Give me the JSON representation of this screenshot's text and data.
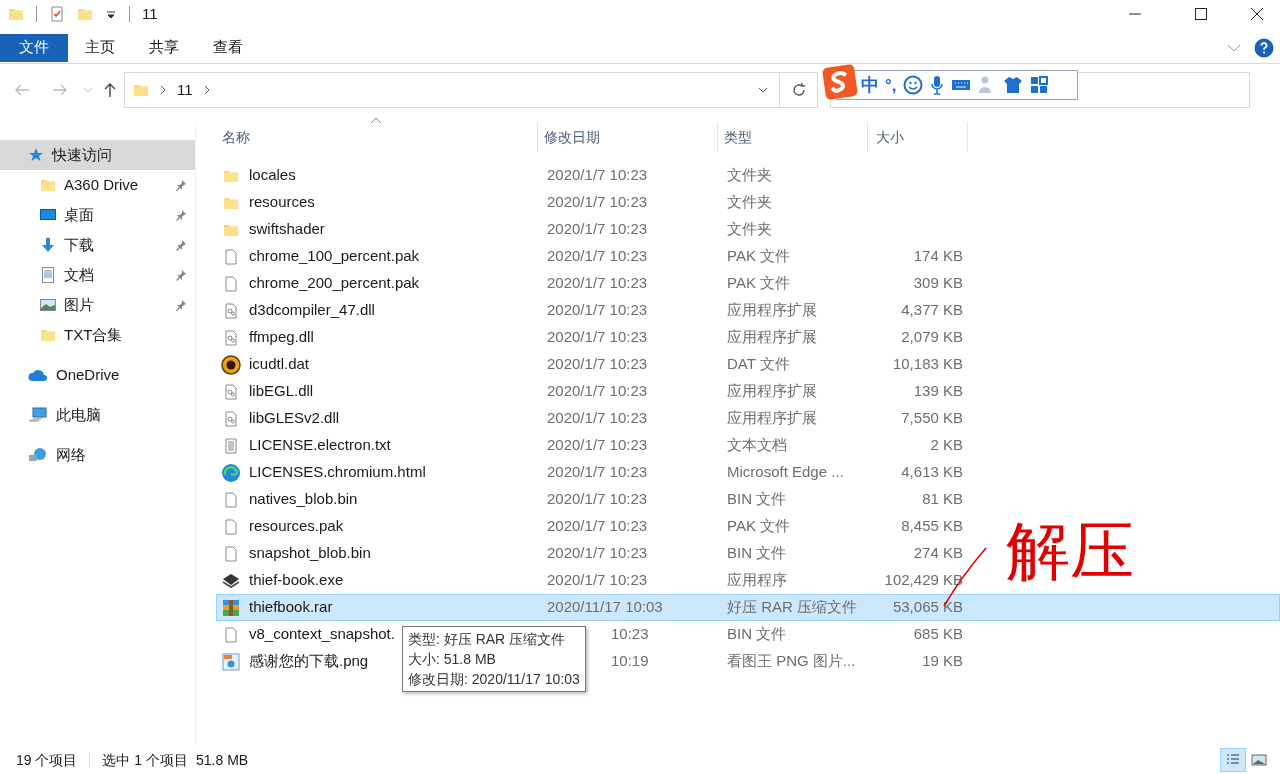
{
  "window": {
    "title": "11"
  },
  "ribbon_tabs": [
    {
      "label": "文件",
      "kind": "file"
    },
    {
      "label": "主页",
      "kind": "tab"
    },
    {
      "label": "共享",
      "kind": "tab"
    },
    {
      "label": "查看",
      "kind": "tab"
    }
  ],
  "address": {
    "crumbs": [
      "11"
    ]
  },
  "ime_toolbar": {
    "mode": "中",
    "punctuation": "°,"
  },
  "sidebar": {
    "items": [
      {
        "label": "快速访问",
        "kind": "star",
        "selected": true,
        "children": [
          {
            "label": "A360 Drive",
            "kind": "folder",
            "pinned": true,
            "selected": false
          },
          {
            "label": "桌面",
            "kind": "desktop",
            "pinned": true,
            "selected": false
          },
          {
            "label": "下载",
            "kind": "download",
            "pinned": true,
            "selected": false
          },
          {
            "label": "文档",
            "kind": "document",
            "pinned": true,
            "selected": false
          },
          {
            "label": "图片",
            "kind": "pictures",
            "pinned": true,
            "selected": false
          },
          {
            "label": "TXT合集",
            "kind": "folder",
            "pinned": false,
            "selected": false
          }
        ]
      },
      {
        "label": "OneDrive",
        "kind": "cloud",
        "selected": false
      },
      {
        "label": "此电脑",
        "kind": "computer",
        "selected": false
      },
      {
        "label": "网络",
        "kind": "network",
        "selected": false
      }
    ]
  },
  "table": {
    "columns": [
      "名称",
      "修改日期",
      "类型",
      "大小"
    ],
    "rows": [
      {
        "kind": "folder",
        "name": "locales",
        "date": "2020/1/7 10:23",
        "type": "文件夹",
        "selected": false,
        "covered": false
      },
      {
        "kind": "folder",
        "name": "resources",
        "date": "2020/1/7 10:23",
        "type": "文件夹",
        "selected": false,
        "covered": false
      },
      {
        "kind": "folder",
        "name": "swiftshader",
        "date": "2020/1/7 10:23",
        "type": "文件夹",
        "selected": false,
        "covered": false
      },
      {
        "kind": "file",
        "name": "chrome_100_percent.pak",
        "date": "2020/1/7 10:23",
        "type": "PAK 文件",
        "size": "174 KB",
        "selected": false,
        "covered": false
      },
      {
        "kind": "file",
        "name": "chrome_200_percent.pak",
        "date": "2020/1/7 10:23",
        "type": "PAK 文件",
        "size": "309 KB",
        "selected": false,
        "covered": false
      },
      {
        "kind": "dll",
        "name": "d3dcompiler_47.dll",
        "date": "2020/1/7 10:23",
        "type": "应用程序扩展",
        "size": "4,377 KB",
        "selected": false,
        "covered": false
      },
      {
        "kind": "dll",
        "name": "ffmpeg.dll",
        "date": "2020/1/7 10:23",
        "type": "应用程序扩展",
        "size": "2,079 KB",
        "selected": false,
        "covered": false
      },
      {
        "kind": "dat",
        "name": "icudtl.dat",
        "date": "2020/1/7 10:23",
        "type": "DAT 文件",
        "size": "10,183 KB",
        "selected": false,
        "covered": false
      },
      {
        "kind": "dll",
        "name": "libEGL.dll",
        "date": "2020/1/7 10:23",
        "type": "应用程序扩展",
        "size": "139 KB",
        "selected": false,
        "covered": false
      },
      {
        "kind": "dll",
        "name": "libGLESv2.dll",
        "date": "2020/1/7 10:23",
        "type": "应用程序扩展",
        "size": "7,550 KB",
        "selected": false,
        "covered": false
      },
      {
        "kind": "text",
        "name": "LICENSE.electron.txt",
        "date": "2020/1/7 10:23",
        "type": "文本文档",
        "size": "2 KB",
        "selected": false,
        "covered": false
      },
      {
        "kind": "edge",
        "name": "LICENSES.chromium.html",
        "date": "2020/1/7 10:23",
        "type": "Microsoft Edge ...",
        "size": "4,613 KB",
        "selected": false,
        "covered": false
      },
      {
        "kind": "file",
        "name": "natives_blob.bin",
        "date": "2020/1/7 10:23",
        "type": "BIN 文件",
        "size": "81 KB",
        "selected": false,
        "covered": false
      },
      {
        "kind": "file",
        "name": "resources.pak",
        "date": "2020/1/7 10:23",
        "type": "PAK 文件",
        "size": "8,455 KB",
        "selected": false,
        "covered": false
      },
      {
        "kind": "file",
        "name": "snapshot_blob.bin",
        "date": "2020/1/7 10:23",
        "type": "BIN 文件",
        "size": "274 KB",
        "selected": false,
        "covered": false
      },
      {
        "kind": "exe",
        "name": "thief-book.exe",
        "date": "2020/1/7 10:23",
        "type": "应用程序",
        "size": "102,429 KB",
        "selected": false,
        "covered": false
      },
      {
        "kind": "rar",
        "name": "thiefbook.rar",
        "date": "2020/11/17 10:03",
        "type": "好压 RAR 压缩文件",
        "size": "53,065 KB",
        "selected": true,
        "covered": false
      },
      {
        "kind": "file",
        "name": "v8_context_snapshot.",
        "date": "10:23",
        "type": "BIN 文件",
        "size": "685 KB",
        "selected": false,
        "covered": true
      },
      {
        "kind": "image",
        "name": "感谢您的下载.png",
        "date": "10:19",
        "type": "看图王 PNG 图片...",
        "size": "19 KB",
        "selected": false,
        "covered": true
      }
    ]
  },
  "tooltip": {
    "lines": [
      "类型: 好压 RAR 压缩文件",
      "大小: 51.8 MB",
      "修改日期: 2020/11/17 10:03"
    ]
  },
  "annotation": {
    "text": "解压"
  },
  "status_bar": {
    "count": "19 个项目",
    "selection": "选中 1 个项目",
    "size": "51.8 MB"
  }
}
